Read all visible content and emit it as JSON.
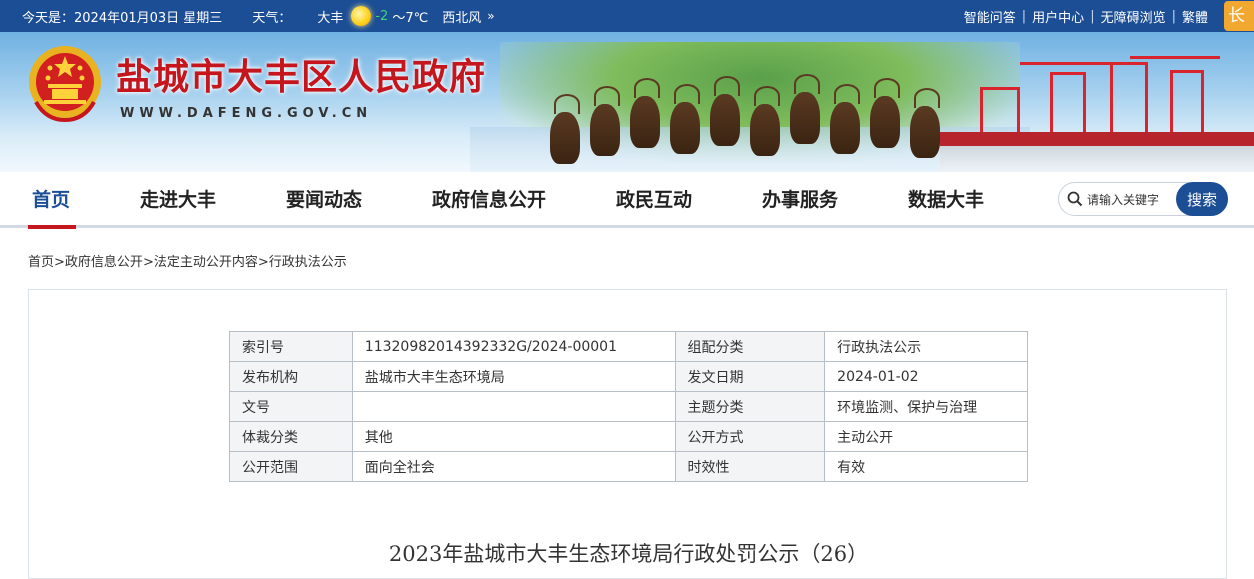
{
  "topbar": {
    "date_text": "今天是：2024年01月03日 星期三",
    "weather_label": "天气：",
    "weather_city": "大丰",
    "weather_icon": "sun-icon",
    "temp_low": "-2",
    "temp_high": "～7℃",
    "wind": "西北风",
    "more_icon": "double-chevron-right-icon",
    "links": [
      "智能问答",
      "用户中心",
      "无障碍浏览",
      "繁體"
    ],
    "elder_mode": "长者"
  },
  "banner": {
    "title": "盐城市大丰区人民政府",
    "url": "WWW.DAFENG.GOV.CN"
  },
  "nav": {
    "items": [
      "首页",
      "走进大丰",
      "要闻动态",
      "政府信息公开",
      "政民互动",
      "办事服务",
      "数据大丰"
    ]
  },
  "search": {
    "placeholder": "请输入关键字",
    "button": "搜索"
  },
  "breadcrumb": [
    "首页",
    "政府信息公开",
    "法定主动公开内容",
    "行政执法公示"
  ],
  "breadcrumb_sep": ">",
  "meta": {
    "rows": [
      [
        "索引号",
        "11320982014392332G/2024-00001",
        "组配分类",
        "行政执法公示"
      ],
      [
        "发布机构",
        "盐城市大丰生态环境局",
        "发文日期",
        "2024-01-02"
      ],
      [
        "文号",
        "",
        "主题分类",
        "环境监测、保护与治理"
      ],
      [
        "体裁分类",
        "其他",
        "公开方式",
        "主动公开"
      ],
      [
        "公开范围",
        "面向全社会",
        "时效性",
        "有效"
      ]
    ]
  },
  "doc_title": "2023年盐城市大丰生态环境局行政处罚公示（26）",
  "colors": {
    "brand_blue": "#1c4e96",
    "title_red": "#c5151d",
    "elder_orange": "#f0a830"
  }
}
